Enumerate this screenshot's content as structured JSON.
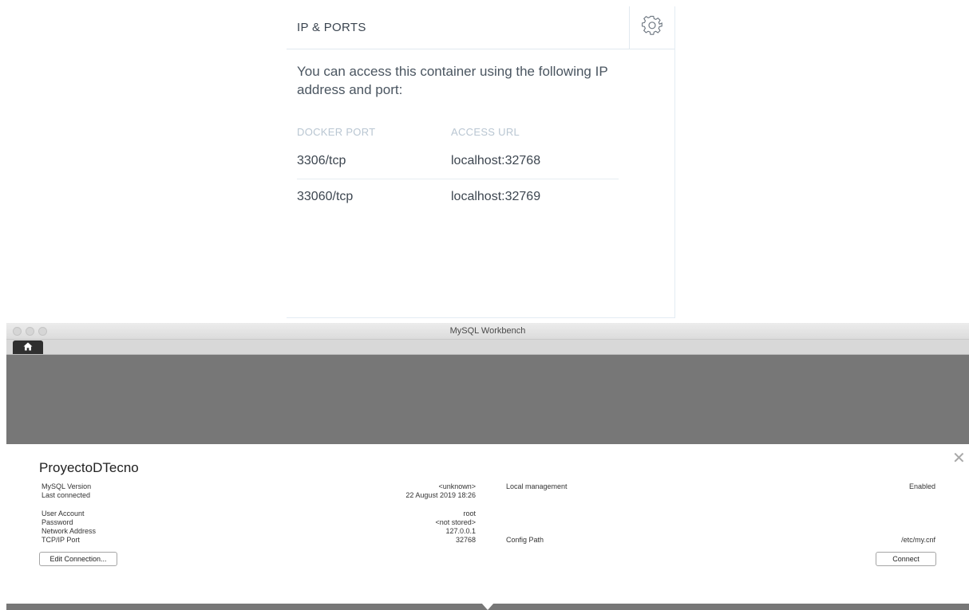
{
  "ports_panel": {
    "title": "IP & PORTS",
    "intro": "You can access this container using the following IP address and port:",
    "columns": {
      "docker_port": "DOCKER PORT",
      "access_url": "ACCESS URL"
    },
    "rows": [
      {
        "port": "3306/tcp",
        "url": "localhost:32768"
      },
      {
        "port": "33060/tcp",
        "url": "localhost:32769"
      }
    ],
    "icons": {
      "settings": "gear-icon"
    }
  },
  "workbench": {
    "window_title": "MySQL Workbench",
    "home_tab_icon": "home-icon",
    "connection_name": "ProyectoDTecno",
    "details": {
      "mysql_version_label": "MySQL Version",
      "mysql_version_value": "<unknown>",
      "last_connected_label": "Last connected",
      "last_connected_value": "22 August 2019 18:26",
      "user_account_label": "User Account",
      "user_account_value": "root",
      "password_label": "Password",
      "password_value": "<not stored>",
      "network_address_label": "Network Address",
      "network_address_value": "127.0.0.1",
      "tcp_port_label": "TCP/IP Port",
      "tcp_port_value": "32768",
      "local_management_label": "Local management",
      "local_management_value": "Enabled",
      "config_path_label": "Config Path",
      "config_path_value": "/etc/my.cnf"
    },
    "buttons": {
      "edit_connection": "Edit Connection...",
      "connect": "Connect"
    },
    "close_glyph": "✕"
  },
  "colors": {
    "panel_border": "#e1e9ef",
    "workbench_dark": "#777777",
    "table_header": "#b9c6d2"
  }
}
